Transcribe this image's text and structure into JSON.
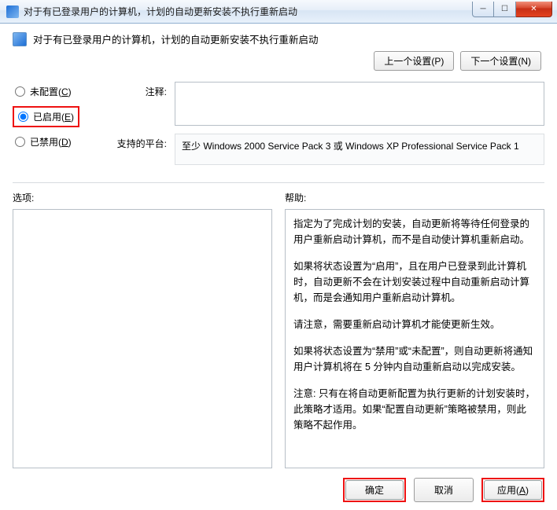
{
  "window": {
    "title": "对于有已登录用户的计算机，计划的自动更新安装不执行重新启动"
  },
  "header": {
    "policy_title": "对于有已登录用户的计算机，计划的自动更新安装不执行重新启动",
    "prev_label": "上一个设置(P)",
    "next_label": "下一个设置(N)"
  },
  "radios": {
    "not_configured": "未配置(",
    "not_configured_key": "C",
    "enabled": "已启用(",
    "enabled_key": "E",
    "disabled": "已禁用(",
    "disabled_key": "D",
    "close_paren": ")"
  },
  "fields": {
    "comment_label": "注释:",
    "comment_value": "",
    "platform_label": "支持的平台:",
    "platform_value": "至少 Windows 2000 Service Pack 3 或 Windows XP Professional Service Pack 1"
  },
  "lower": {
    "options_label": "选项:",
    "help_label": "帮助:",
    "help_p1": "指定为了完成计划的安装，自动更新将等待任何登录的用户重新启动计算机，而不是自动使计算机重新启动。",
    "help_p2": "如果将状态设置为“启用”，且在用户已登录到此计算机时，自动更新不会在计划安装过程中自动重新启动计算机，而是会通知用户重新启动计算机。",
    "help_p3": "请注意，需要重新启动计算机才能使更新生效。",
    "help_p4": "如果将状态设置为“禁用”或“未配置”，则自动更新将通知用户计算机将在 5 分钟内自动重新启动以完成安装。",
    "help_p5": "注意: 只有在将自动更新配置为执行更新的计划安装时，此策略才适用。如果“配置自动更新”策略被禁用，则此策略不起作用。"
  },
  "footer": {
    "ok": "确定",
    "cancel": "取消",
    "apply": "应用(",
    "apply_key": "A",
    "close_paren": ")"
  }
}
